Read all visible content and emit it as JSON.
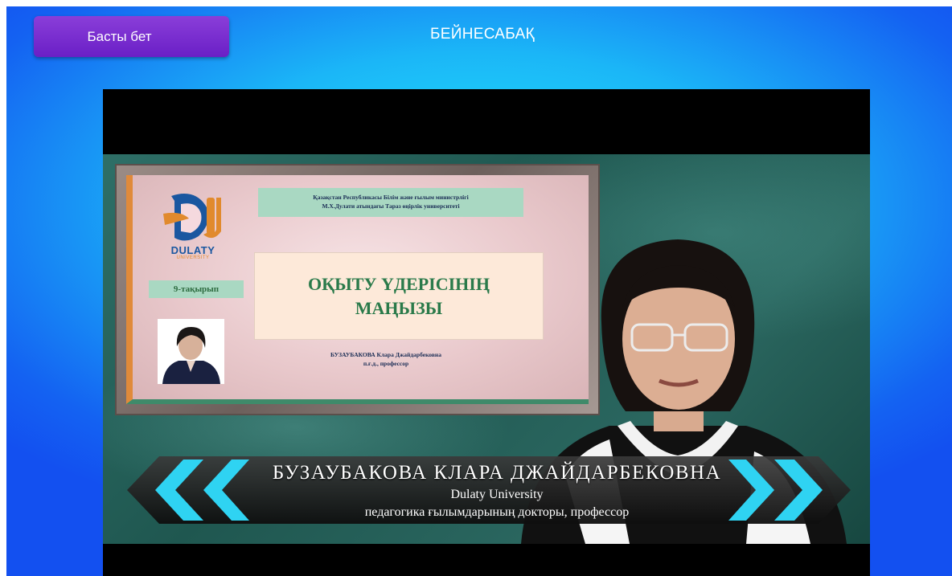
{
  "header": {
    "home_button_label": "Басты бет",
    "page_title": "БЕЙНЕСАБАҚ"
  },
  "video": {
    "slide": {
      "ministry_line1": "Қазақстан Республикасы Білім және ғылым министрлігі",
      "ministry_line2": "М.Х.Дулати атындағы Тараз өңірлік университеті",
      "logo_text": "DULATY",
      "logo_subtext": "UNIVERSITY",
      "topic_label": "9-тақырып",
      "title_line1": "ОҚЫТУ ҮДЕРІСІНІҢ",
      "title_line2": "МАҢЫЗЫ",
      "author_line1": "БУЗАУБАКОВА Клара Джайдарбековна",
      "author_line2": "п.ғ.д., профессор"
    },
    "lower_third": {
      "name": "БУЗАУБАКОВА КЛАРА ДЖАЙДАРБЕКОВНА",
      "organization": "Dulaty University",
      "role": "педагогика ғылымдарының докторы, профессор"
    }
  },
  "colors": {
    "home_button": "#7a2ed0",
    "background_center": "#22ecfb",
    "background_edge": "#1350f0",
    "chevron_accent": "#2fd3f2"
  }
}
